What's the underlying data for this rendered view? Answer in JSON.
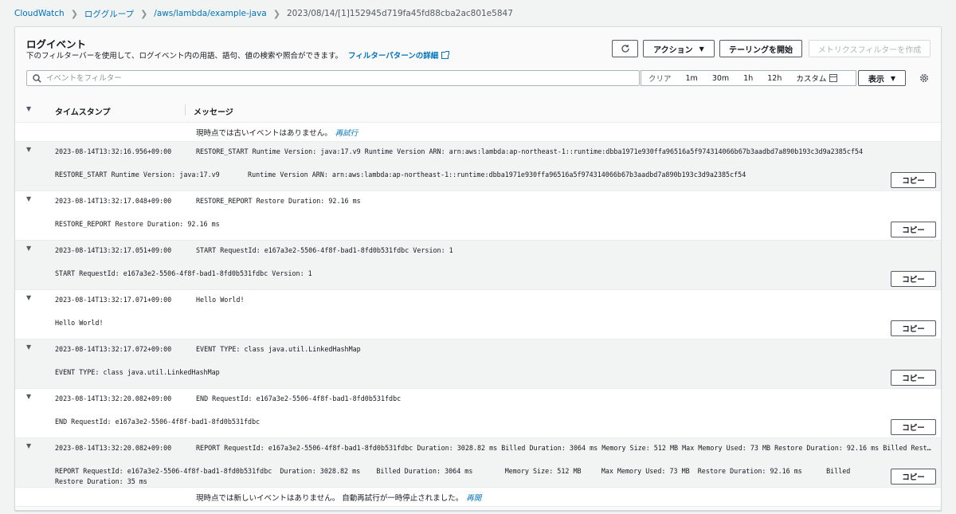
{
  "breadcrumb": {
    "items": [
      "CloudWatch",
      "ロググループ",
      "/aws/lambda/example-java"
    ],
    "current": "2023/08/14/[1]152945d719fa45fd88cba2ac801e5847"
  },
  "panel": {
    "title": "ログイベント",
    "description": "下のフィルターバーを使用して、ログイベント内の用語、語句、値の検索や照合ができます。",
    "description_link": "フィルターパターンの詳細"
  },
  "toolbar": {
    "actions_label": "アクション",
    "tail_label": "テーリングを開始",
    "metric_filter_label": "メトリクスフィルターを作成"
  },
  "search": {
    "placeholder": "イベントをフィルター"
  },
  "time_range": {
    "clear": "クリア",
    "options": [
      "1m",
      "30m",
      "1h",
      "12h"
    ],
    "custom": "カスタム"
  },
  "display_label": "表示",
  "table": {
    "col_timestamp": "タイムスタンプ",
    "col_message": "メッセージ",
    "older_notice": "現時点では古いイベントはありません。",
    "retry_link": "再試行",
    "newer_notice": "現時点では新しいイベントはありません。 自動再試行が一時停止されました。",
    "resume_link": "再開",
    "copy_label": "コピー",
    "rows": [
      {
        "timestamp": "2023-08-14T13:32:16.956+09:00",
        "message": "RESTORE_START Runtime Version: java:17.v9 Runtime Version ARN: arn:aws:lambda:ap-northeast-1::runtime:dbba1971e930ffa96516a5f974314066b67b3aadbd7a890b193c3d9a2385cf54",
        "detail": "RESTORE_START Runtime Version: java:17.v9\tRuntime Version ARN: arn:aws:lambda:ap-northeast-1::runtime:dbba1971e930ffa96516a5f974314066b67b3aadbd7a890b193c3d9a2385cf54"
      },
      {
        "timestamp": "2023-08-14T13:32:17.048+09:00",
        "message": "RESTORE_REPORT Restore Duration: 92.16 ms",
        "detail": "RESTORE_REPORT Restore Duration: 92.16 ms"
      },
      {
        "timestamp": "2023-08-14T13:32:17.051+09:00",
        "message": "START RequestId: e167a3e2-5506-4f8f-bad1-8fd0b531fdbc Version: 1",
        "detail": "START RequestId: e167a3e2-5506-4f8f-bad1-8fd0b531fdbc Version: 1"
      },
      {
        "timestamp": "2023-08-14T13:32:17.071+09:00",
        "message": "Hello World!",
        "detail": "Hello World!"
      },
      {
        "timestamp": "2023-08-14T13:32:17.072+09:00",
        "message": "EVENT TYPE: class java.util.LinkedHashMap",
        "detail": "EVENT TYPE: class java.util.LinkedHashMap"
      },
      {
        "timestamp": "2023-08-14T13:32:20.082+09:00",
        "message": "END RequestId: e167a3e2-5506-4f8f-bad1-8fd0b531fdbc",
        "detail": "END RequestId: e167a3e2-5506-4f8f-bad1-8fd0b531fdbc"
      },
      {
        "timestamp": "2023-08-14T13:32:20.082+09:00",
        "message": "REPORT RequestId: e167a3e2-5506-4f8f-bad1-8fd0b531fdbc Duration: 3028.82 ms Billed Duration: 3064 ms Memory Size: 512 MB Max Memory Used: 73 MB Restore Duration: 92.16 ms Billed Restore Duration: 35 ms",
        "detail": "REPORT RequestId: e167a3e2-5506-4f8f-bad1-8fd0b531fdbc  Duration: 3028.82 ms    Billed Duration: 3064 ms        Memory Size: 512 MB     Max Memory Used: 73 MB  Restore Duration: 92.16 ms      Billed Restore Duration: 35 ms"
      }
    ]
  },
  "colors": {
    "link": "#0073bb",
    "border": "#d5dbdb",
    "text": "#16191f",
    "row_alt": "#f2f3f3"
  },
  "icons": [
    "chevron-right-icon",
    "external-link-icon",
    "refresh-icon",
    "caret-down-icon",
    "search-icon",
    "calendar-icon",
    "gear-icon",
    "expand-triangle-icon"
  ]
}
